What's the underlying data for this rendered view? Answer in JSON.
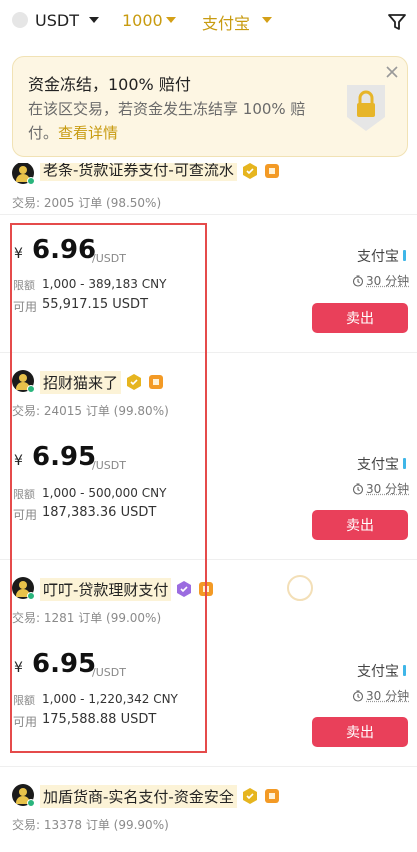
{
  "filters": {
    "coin": "USDT",
    "amount": "1000",
    "payment": "支付宝"
  },
  "banner": {
    "title": "资金冻结，100% 赔付",
    "text": "在该区交易，若资金发生冻结享 100% 赔付。",
    "link": "查看详情"
  },
  "partial_top": {
    "merchant": "老条-货款证券支付-可查流水",
    "trades": "交易: 2005 订单 (98.50%)"
  },
  "offers": [
    {
      "price": "6.96",
      "unit": "/USDT",
      "currency_symbol": "¥",
      "limit_label": "限额",
      "limit": "1,000 - 389,183 CNY",
      "available_label": "可用",
      "available": "55,917.15 USDT",
      "method": "支付宝",
      "time": "30 分钟",
      "action": "卖出"
    },
    {
      "merchant": "招财猫来了",
      "trades": "交易: 24015 订单 (99.80%)",
      "price": "6.95",
      "unit": "/USDT",
      "currency_symbol": "¥",
      "limit_label": "限额",
      "limit": "1,000 - 500,000 CNY",
      "available_label": "可用",
      "available": "187,383.36 USDT",
      "method": "支付宝",
      "time": "30 分钟",
      "action": "卖出"
    },
    {
      "merchant": "叮叮-贷款理财支付",
      "trades": "交易: 1281 订单 (99.00%)",
      "price": "6.95",
      "unit": "/USDT",
      "currency_symbol": "¥",
      "limit_label": "限额",
      "limit": "1,000 - 1,220,342 CNY",
      "available_label": "可用",
      "available": "175,588.88 USDT",
      "method": "支付宝",
      "time": "30 分钟",
      "action": "卖出"
    }
  ],
  "bottom": {
    "merchant": "加盾货商-实名支付-资金安全",
    "trades": "交易: 13378 订单 (99.90%)"
  },
  "colors": {
    "accent_gold": "#c89b10",
    "sell_red": "#e9405a",
    "highlight_red": "#e54b4b",
    "online_green": "#2ab57d"
  }
}
